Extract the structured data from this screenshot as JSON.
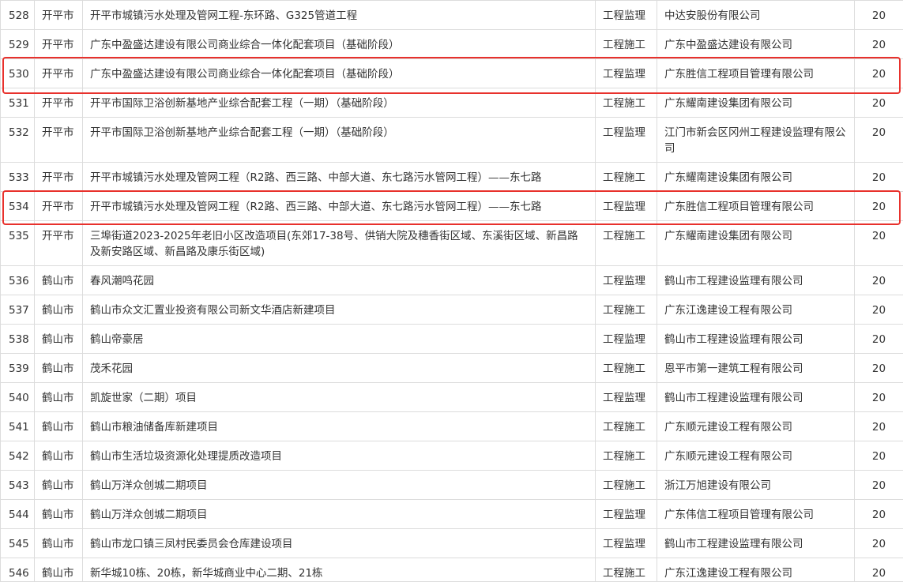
{
  "table": {
    "rows": [
      {
        "num": "528",
        "city": "开平市",
        "project": "开平市城镇污水处理及管网工程-东环路、G325管道工程",
        "type": "工程监理",
        "company": "中达安股份有限公司",
        "score": "20",
        "lines": 1
      },
      {
        "num": "529",
        "city": "开平市",
        "project": "广东中盈盛达建设有限公司商业综合一体化配套项目（基础阶段）",
        "type": "工程施工",
        "company": "广东中盈盛达建设有限公司",
        "score": "20",
        "lines": 1
      },
      {
        "num": "530",
        "city": "开平市",
        "project": "广东中盈盛达建设有限公司商业综合一体化配套项目（基础阶段）",
        "type": "工程监理",
        "company": "广东胜信工程项目管理有限公司",
        "score": "20",
        "lines": 1
      },
      {
        "num": "531",
        "city": "开平市",
        "project": "开平市国际卫浴创新基地产业综合配套工程（一期）（基础阶段）",
        "type": "工程施工",
        "company": "广东耀南建设集团有限公司",
        "score": "20",
        "lines": 1
      },
      {
        "num": "532",
        "city": "开平市",
        "project": "开平市国际卫浴创新基地产业综合配套工程（一期）（基础阶段）",
        "type": "工程监理",
        "company": "江门市新会区冈州工程建设监理有限公司",
        "score": "20",
        "lines": 2
      },
      {
        "num": "533",
        "city": "开平市",
        "project": "开平市城镇污水处理及管网工程（R2路、西三路、中部大道、东七路污水管网工程）——东七路",
        "type": "工程施工",
        "company": "广东耀南建设集团有限公司",
        "score": "20",
        "lines": 1
      },
      {
        "num": "534",
        "city": "开平市",
        "project": "开平市城镇污水处理及管网工程（R2路、西三路、中部大道、东七路污水管网工程）——东七路",
        "type": "工程监理",
        "company": "广东胜信工程项目管理有限公司",
        "score": "20",
        "lines": 1
      },
      {
        "num": "535",
        "city": "开平市",
        "project": "三埠街道2023-2025年老旧小区改造项目(东郊17-38号、供销大院及穗香街区域、东溪街区域、新昌路及新安路区域、新昌路及康乐街区域)",
        "type": "工程施工",
        "company": "广东耀南建设集团有限公司",
        "score": "20",
        "lines": 2
      },
      {
        "num": "536",
        "city": "鹤山市",
        "project": "春风潮鸣花园",
        "type": "工程监理",
        "company": "鹤山市工程建设监理有限公司",
        "score": "20",
        "lines": 1
      },
      {
        "num": "537",
        "city": "鹤山市",
        "project": "鹤山市众文汇置业投资有限公司新文华酒店新建项目",
        "type": "工程施工",
        "company": "广东江逸建设工程有限公司",
        "score": "20",
        "lines": 1
      },
      {
        "num": "538",
        "city": "鹤山市",
        "project": "鹤山帝豪居",
        "type": "工程监理",
        "company": "鹤山市工程建设监理有限公司",
        "score": "20",
        "lines": 1
      },
      {
        "num": "539",
        "city": "鹤山市",
        "project": "茂禾花园",
        "type": "工程施工",
        "company": "恩平市第一建筑工程有限公司",
        "score": "20",
        "lines": 1
      },
      {
        "num": "540",
        "city": "鹤山市",
        "project": "凯旋世家（二期）项目",
        "type": "工程监理",
        "company": "鹤山市工程建设监理有限公司",
        "score": "20",
        "lines": 1
      },
      {
        "num": "541",
        "city": "鹤山市",
        "project": "鹤山市粮油储备库新建项目",
        "type": "工程施工",
        "company": "广东顺元建设工程有限公司",
        "score": "20",
        "lines": 1
      },
      {
        "num": "542",
        "city": "鹤山市",
        "project": "鹤山市生活垃圾资源化处理提质改造项目",
        "type": "工程施工",
        "company": "广东顺元建设工程有限公司",
        "score": "20",
        "lines": 1
      },
      {
        "num": "543",
        "city": "鹤山市",
        "project": "鹤山万洋众创城二期项目",
        "type": "工程施工",
        "company": "浙江万旭建设有限公司",
        "score": "20",
        "lines": 1
      },
      {
        "num": "544",
        "city": "鹤山市",
        "project": "鹤山万洋众创城二期项目",
        "type": "工程监理",
        "company": "广东伟信工程项目管理有限公司",
        "score": "20",
        "lines": 1
      },
      {
        "num": "545",
        "city": "鹤山市",
        "project": "鹤山市龙口镇三凤村民委员会仓库建设项目",
        "type": "工程监理",
        "company": "鹤山市工程建设监理有限公司",
        "score": "20",
        "lines": 1
      },
      {
        "num": "546",
        "city": "鹤山市",
        "project": "新华城10栋、20栋，新华城商业中心二期、21栋",
        "type": "工程施工",
        "company": "广东江逸建设工程有限公司",
        "score": "20",
        "lines": 0
      }
    ],
    "highlighted_rows": [
      "530",
      "534"
    ],
    "highlight_color": "#e8312c",
    "border_color": "#dcdcdc",
    "text_color": "#333333"
  }
}
